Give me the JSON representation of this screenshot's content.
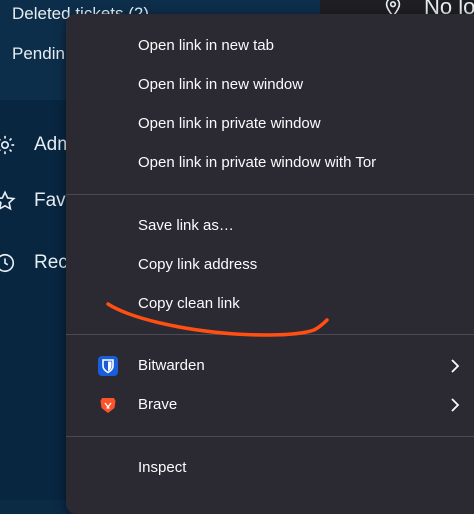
{
  "background": {
    "sidebar_items": [
      {
        "label": "Deleted tickets (2)",
        "icon": ""
      },
      {
        "label": "Pendin",
        "icon": ""
      },
      {
        "label": "Adm",
        "icon": "gear-icon"
      },
      {
        "label": "Fav",
        "icon": "star-icon"
      },
      {
        "label": "Rec",
        "icon": "clock-icon"
      }
    ],
    "top_right_text": "No lo",
    "top_right_icon": "location-pin-icon"
  },
  "context_menu": {
    "open_new_tab": "Open link in new tab",
    "open_new_window": "Open link in new window",
    "open_private_window": "Open link in private window",
    "open_private_tor": "Open link in private window with Tor",
    "save_link_as": "Save link as…",
    "copy_link_address": "Copy link address",
    "copy_clean_link": "Copy clean link",
    "bitwarden": {
      "label": "Bitwarden",
      "icon": "bitwarden-shield-icon",
      "color": "#175ddc"
    },
    "brave": {
      "label": "Brave",
      "icon": "brave-lion-icon",
      "color": "#fb542b"
    },
    "inspect": "Inspect"
  },
  "colors": {
    "menu_bg": "#2b2a33",
    "menu_text": "#fbfbfe",
    "annotation": "#ff4f12",
    "page_bg": "#082640"
  }
}
